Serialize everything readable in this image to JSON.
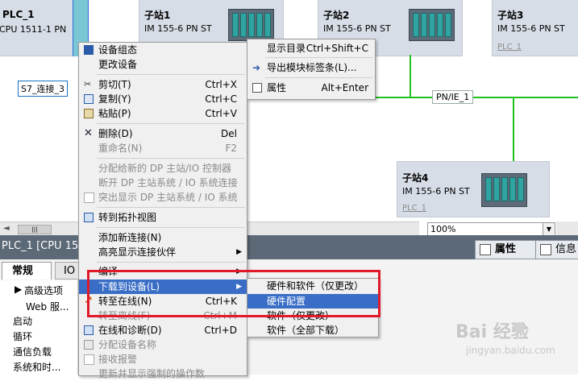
{
  "network": {
    "plc": {
      "name": "PLC_1",
      "type": "CPU 1511-1 PN"
    },
    "connection_label": "S7_连接_3",
    "stations": [
      {
        "name": "子站1",
        "type": "IM 155-6 PN ST",
        "link": ""
      },
      {
        "name": "子站2",
        "type": "IM 155-6 PN ST",
        "link": ""
      },
      {
        "name": "子站3",
        "type": "IM 155-6 PN ST",
        "link": "PLC_1"
      },
      {
        "name": "子站4",
        "type": "IM 155-6 PN ST",
        "link": "PLC_1"
      }
    ],
    "subnet_label": "PN/IE_1",
    "zoom": "100%",
    "scroll_glyph": "|||",
    "scroll_arrow": "◄"
  },
  "inspector": {
    "title": "PLC_1 [CPU 15",
    "properties_tab": "属性",
    "info_tab": "信息",
    "tab_general": "常规",
    "tab_io": "IO",
    "nav": {
      "advanced": "高级选项",
      "web": "Web 服...",
      "startup": "启动",
      "cycle": "循环",
      "comm_load": "通信负载",
      "sys_clock": "系统和时..."
    }
  },
  "context_menu": {
    "items": [
      {
        "label": "设备组态",
        "shortcut": ""
      },
      {
        "label": "更改设备",
        "shortcut": ""
      },
      {
        "label": "剪切(T)",
        "shortcut": "Ctrl+X"
      },
      {
        "label": "复制(Y)",
        "shortcut": "Ctrl+C"
      },
      {
        "label": "粘贴(P)",
        "shortcut": "Ctrl+V"
      },
      {
        "label": "删除(D)",
        "shortcut": "Del"
      },
      {
        "label": "重命名(N)",
        "shortcut": "F2"
      },
      {
        "label": "分配给新的 DP 主站/IO 控制器",
        "shortcut": ""
      },
      {
        "label": "断开 DP 主站系统 / IO 系统连接",
        "shortcut": ""
      },
      {
        "label": "突出显示 DP 主站系统 / IO 系统",
        "shortcut": ""
      },
      {
        "label": "转到拓扑视图",
        "shortcut": ""
      },
      {
        "label": "添加新连接(N)",
        "shortcut": ""
      },
      {
        "label": "高亮显示连接伙伴",
        "shortcut": ""
      },
      {
        "label": "编译",
        "shortcut": ""
      },
      {
        "label": "下载到设备(L)",
        "shortcut": ""
      },
      {
        "label": "转至在线(N)",
        "shortcut": "Ctrl+K"
      },
      {
        "label": "转至离线(F)",
        "shortcut": "Ctrl+M"
      },
      {
        "label": "在线和诊断(D)",
        "shortcut": "Ctrl+D"
      },
      {
        "label": "分配设备名称",
        "shortcut": ""
      },
      {
        "label": "接收报警",
        "shortcut": ""
      },
      {
        "label": "更新并显示强制的操作数",
        "shortcut": ""
      }
    ]
  },
  "right_menu": {
    "items": [
      {
        "label": "显示目录",
        "shortcut": "Ctrl+Shift+C"
      },
      {
        "label": "导出模块标签条(L)...",
        "shortcut": ""
      },
      {
        "label": "属性",
        "shortcut": "Alt+Enter"
      }
    ]
  },
  "download_submenu": {
    "items": [
      {
        "label": "硬件和软件（仅更改）"
      },
      {
        "label": "硬件配置"
      },
      {
        "label": "软件（仅更改）"
      },
      {
        "label": "软件（全部下载）"
      }
    ]
  },
  "watermark": {
    "text": "Bai 经验",
    "url": "jingyan.baidu.com"
  },
  "colors": {
    "highlight": "#3a6ec6",
    "red_box": "#e0192b",
    "subnet_green": "#21c121",
    "inspector_bar": "#5c6976"
  }
}
